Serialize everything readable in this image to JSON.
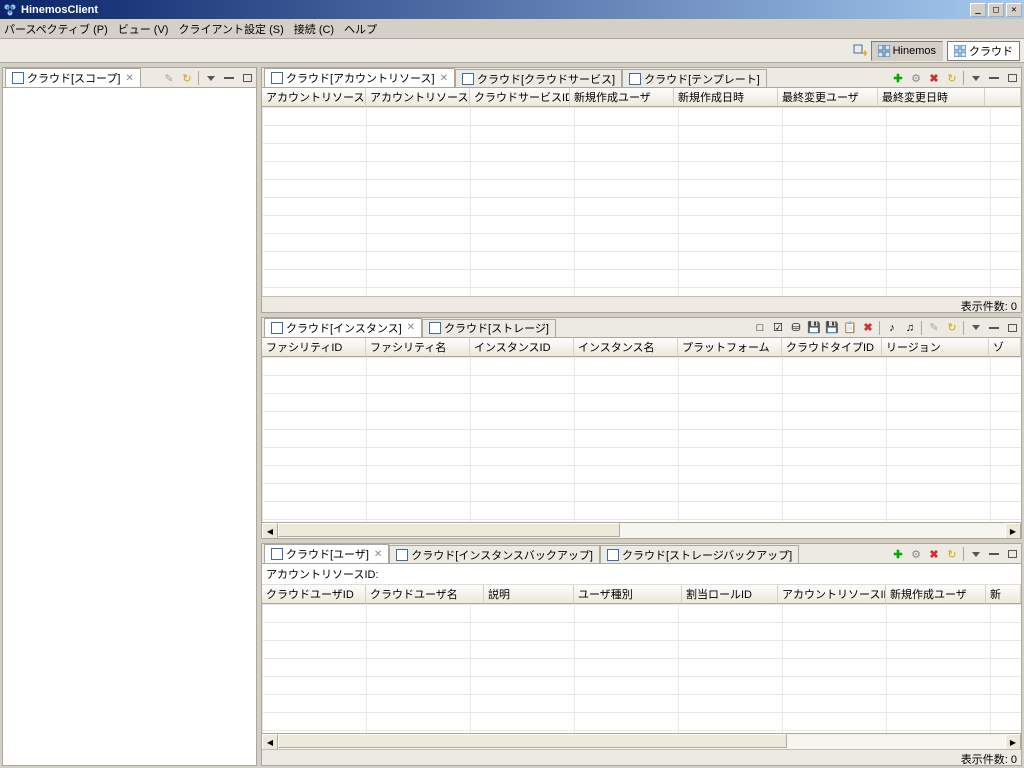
{
  "title": "HinemosClient",
  "menubar": [
    "パースペクティブ (P)",
    "ビュー (V)",
    "クライアント設定 (S)",
    "接続 (C)",
    "ヘルプ"
  ],
  "perspectives": [
    {
      "label": "Hinemos"
    },
    {
      "label": "クラウド",
      "active": true
    }
  ],
  "left_panel": {
    "tabs": [
      {
        "label": "クラウド[スコープ]",
        "active": true
      }
    ]
  },
  "panel1": {
    "tabs": [
      {
        "label": "クラウド[アカウントリソース]",
        "active": true
      },
      {
        "label": "クラウド[クラウドサービス]"
      },
      {
        "label": "クラウド[テンプレート]"
      }
    ],
    "columns": [
      "アカウントリソースID",
      "アカウントリソース名",
      "クラウドサービスID",
      "新規作成ユーザ",
      "新規作成日時",
      "最終変更ユーザ",
      "最終変更日時"
    ],
    "status": "表示件数: 0"
  },
  "panel2": {
    "tabs": [
      {
        "label": "クラウド[インスタンス]",
        "active": true
      },
      {
        "label": "クラウド[ストレージ]"
      }
    ],
    "columns": [
      "ファシリティID",
      "ファシリティ名",
      "インスタンスID",
      "インスタンス名",
      "プラットフォーム",
      "クラウドタイプID",
      "リージョン",
      "ゾ"
    ]
  },
  "panel3": {
    "tabs": [
      {
        "label": "クラウド[ユーザ]",
        "active": true
      },
      {
        "label": "クラウド[インスタンスバックアップ]"
      },
      {
        "label": "クラウド[ストレージバックアップ]"
      }
    ],
    "info": "アカウントリソースID:",
    "columns": [
      "クラウドユーザID",
      "クラウドユーザ名",
      "説明",
      "ユーザ種別",
      "割当ロールID",
      "アカウントリソースID",
      "新規作成ユーザ",
      "新"
    ],
    "status": "表示件数: 0"
  }
}
